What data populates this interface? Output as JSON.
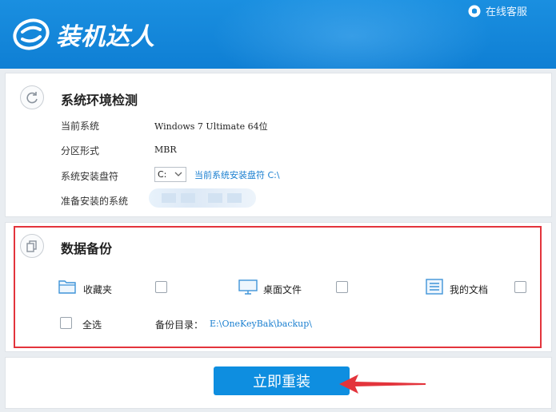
{
  "app": {
    "name": "装机达人",
    "service_label": "在线客服"
  },
  "env": {
    "title": "系统环境检测",
    "rows": [
      {
        "label": "当前系统",
        "value": "Windows 7 Ultimate 64位"
      },
      {
        "label": "分区形式",
        "value": "MBR"
      },
      {
        "label": "系统安装盘符",
        "select_value": "C:",
        "hint": "当前系统安装盘符 C:\\"
      },
      {
        "label": "准备安装的系统"
      }
    ]
  },
  "backup": {
    "title": "数据备份",
    "items": [
      {
        "label": "收藏夹",
        "icon": "folder-icon",
        "checked": false
      },
      {
        "label": "桌面文件",
        "icon": "monitor-icon",
        "checked": false
      },
      {
        "label": "我的文档",
        "icon": "document-icon",
        "checked": false
      }
    ],
    "select_all_label": "全选",
    "dir_label": "备份目录：",
    "dir_path": "E:\\OneKeyBak\\backup\\"
  },
  "footer": {
    "reinstall_label": "立即重装"
  },
  "colors": {
    "header": "#1a8fe0",
    "accent": "#0e8ee0",
    "link": "#1a7fd0",
    "highlight": "#e3343c"
  }
}
